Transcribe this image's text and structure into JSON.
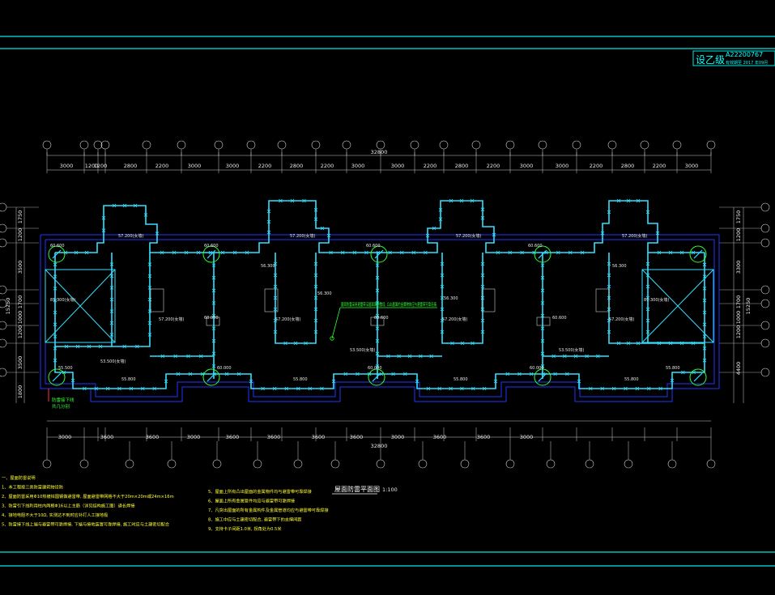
{
  "stamp": {
    "grade": "设乙级",
    "cert_no": "A22200767",
    "valid": "有效期至 2017 年09月"
  },
  "plan": {
    "title": "屋面防雷平面图",
    "scale": "1:100",
    "top_total": "32800",
    "bottom_total": "32800",
    "top_dims": [
      "3000",
      "1200",
      "1200",
      "2800",
      "2200",
      "3000",
      "3000",
      "2200",
      "2800",
      "2200",
      "3000",
      "3000",
      "2200",
      "2800",
      "2200",
      "3000",
      "3000",
      "2200",
      "2800",
      "2200",
      "3000"
    ],
    "bottom_dims": [
      "3000",
      "3600",
      "3600",
      "3000",
      "3600",
      "3600",
      "3600",
      "3600",
      "3000",
      "3600",
      "3600",
      "3000"
    ],
    "left_dims": [
      "1750",
      "1200",
      "3500",
      "1700",
      "1000",
      "1200",
      "3500",
      "1800"
    ],
    "left_total": "15250",
    "right_dims": [
      "1750",
      "1200",
      "3300",
      "1700",
      "1000",
      "1200",
      "4400"
    ],
    "right_total": "15250",
    "elevations": [
      "57.200(女墙)",
      "57.200(女墙)",
      "57.200(女墙)",
      "57.200(女墙)",
      "60.600",
      "60.600",
      "60.600",
      "60.600",
      "60.600",
      "60.600",
      "81.300(女墙)",
      "81.300(女墙)",
      "57.200(女墙)",
      "57.200(女墙)",
      "57.200(女墙)",
      "57.200(女墙)",
      "56.300",
      "56.300",
      "56.300",
      "56.300",
      "53.500(女墙)",
      "53.500(女墙)",
      "53.500(女墙)",
      "55.500",
      "55.800",
      "55.800",
      "55.800",
      "55.800",
      "55.800",
      "60.000",
      "60.000",
      "60.000",
      "60.000"
    ],
    "callout_note": "屋面防雷采用避雷带沿屋面周边敷设, 凸出屋面的金属物体应与避雷带可靠连接",
    "downlead_note": "防雷接下线\n共几分别"
  },
  "notes_left": [
    "一、屋面防雷说明",
    "1、本工程按三类防雷建筑物设防",
    "2、屋面防雷采用Φ10热镀锌圆钢做避雷带, 屋面避雷带网格不大于20m×20m或24m×16m",
    "3、防雷引下线利用柱内两根Φ16以上主筋（详见结构施工图）通长焊接",
    "4、接地电阻不大于10Ω, 实测达不到时应补打人工接地极",
    "5、防雷接下线上端与避雷带可靠焊接, 下端与接地装置可靠焊接, 施工时应与土建密切配合"
  ],
  "notes_right": [
    "5、屋面上所有凸出屋面的金属物件均与避雷带可靠焊接",
    "6、屋面上所有金属管件均应与避雷带可靠焊接",
    "7、凡突出屋面的所有金属构件及金属管道均应与避雷带可靠焊接",
    "8、施工中应与土建密切配合, 避雷带下的支撑间距",
    "9、支持卡子间距1.0米, 拐角处为0.5米"
  ]
}
